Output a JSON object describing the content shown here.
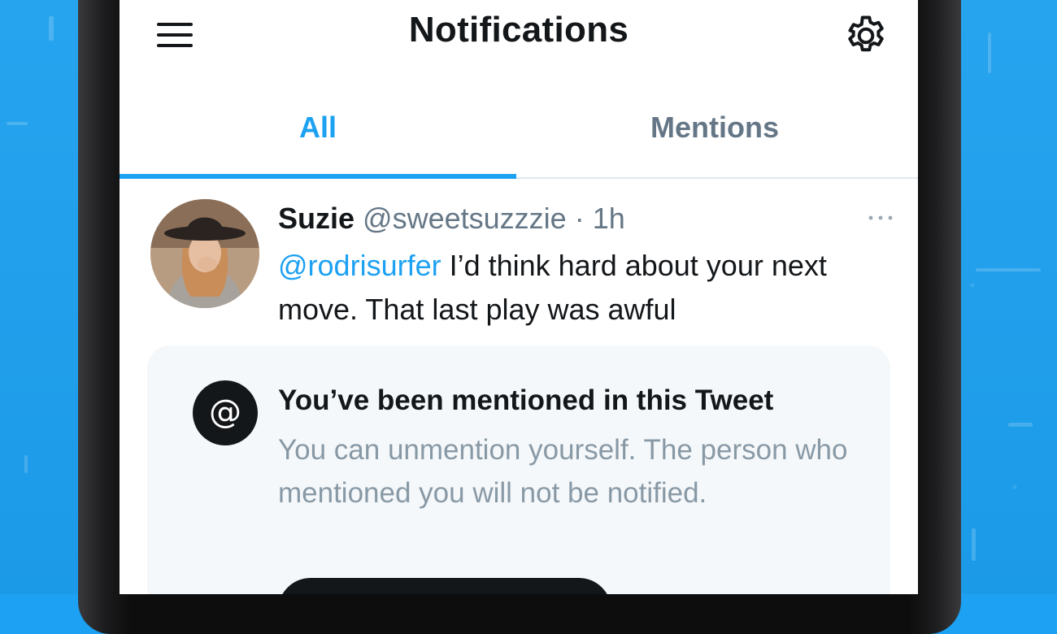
{
  "header": {
    "title": "Notifications",
    "menu_icon": "hamburger-menu-icon",
    "settings_icon": "gear-icon"
  },
  "tabs": [
    {
      "label": "All",
      "active": true
    },
    {
      "label": "Mentions",
      "active": false
    }
  ],
  "tweet": {
    "name": "Suzie",
    "handle": "@sweetsuzzzie",
    "separator": "·",
    "time": "1h",
    "mention": "@rodrisurfer",
    "text": " I’d think hard about your next move. That last play was awful",
    "more_icon": "more-dots-icon"
  },
  "notice": {
    "icon": "at-sign-icon",
    "icon_glyph": "@",
    "title": "You’ve been mentioned in this Tweet",
    "body": "You can unmention yourself. The person who mentioned you will not be notified."
  },
  "colors": {
    "brand_blue": "#1da1f2",
    "text_primary": "#14171a",
    "text_secondary": "#657786",
    "card_background": "#f5f8fa"
  }
}
